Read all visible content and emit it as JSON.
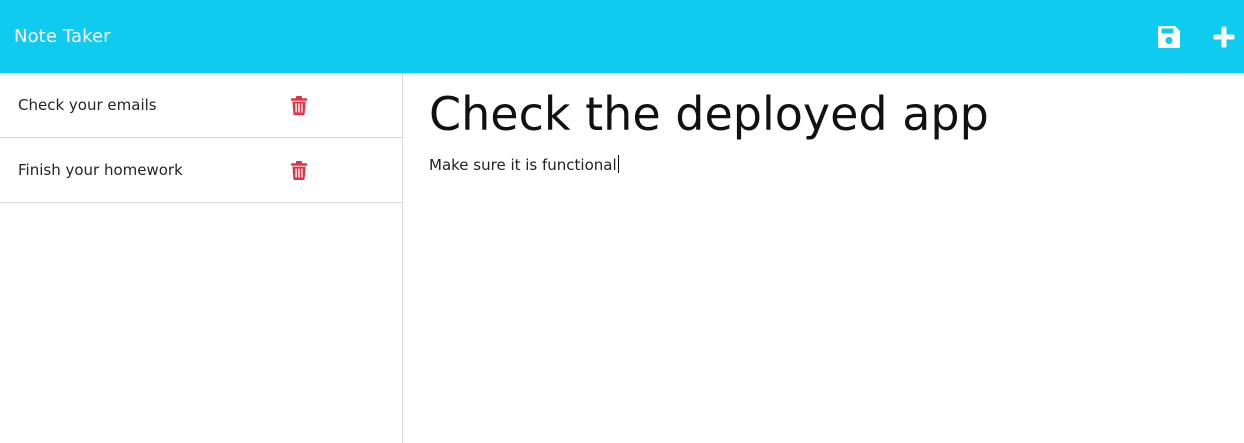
{
  "app": {
    "title": "Note Taker"
  },
  "toolbar": {
    "save_icon": "save-icon",
    "new_icon": "plus-icon"
  },
  "notes": [
    {
      "title": "Check your emails",
      "delete_icon": "trash-icon"
    },
    {
      "title": "Finish your homework",
      "delete_icon": "trash-icon"
    }
  ],
  "editor": {
    "title_value": "Check the deployed app",
    "body_value": "Make sure it is functional"
  },
  "colors": {
    "navbar": "#0fcbef",
    "delete": "#dc3545",
    "icon": "#ffffff"
  }
}
